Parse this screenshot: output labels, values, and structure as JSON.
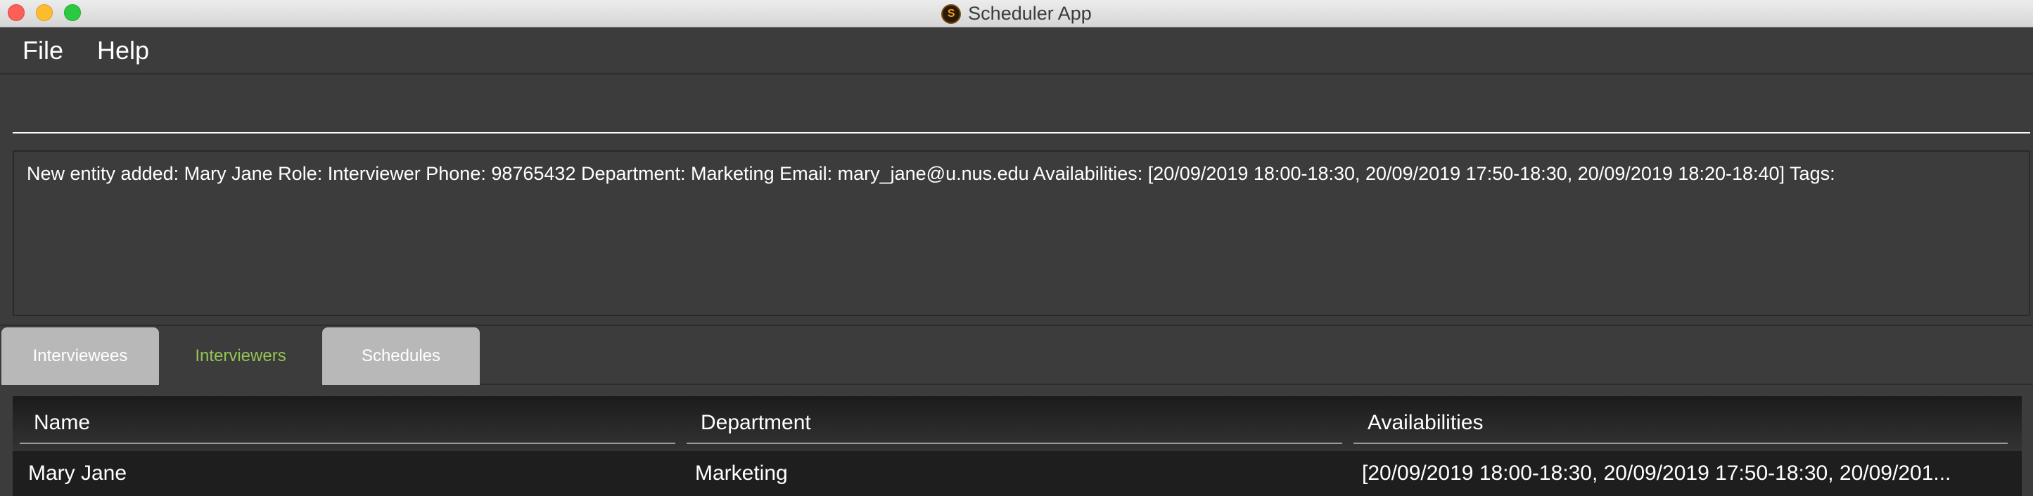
{
  "window": {
    "title": "Scheduler App",
    "app_icon_letter": "S"
  },
  "menu": {
    "items": [
      "File",
      "Help"
    ]
  },
  "command": {
    "value": "",
    "placeholder": ""
  },
  "result": {
    "text": "New entity added: Mary Jane Role: Interviewer Phone: 98765432 Department: Marketing Email: mary_jane@u.nus.edu Availabilities: [20/09/2019 18:00-18:30, 20/09/2019 17:50-18:30, 20/09/2019 18:20-18:40] Tags:"
  },
  "tabs": [
    {
      "label": "Interviewees",
      "selected": false
    },
    {
      "label": "Interviewers",
      "selected": true
    },
    {
      "label": "Schedules",
      "selected": false
    }
  ],
  "table": {
    "columns": [
      "Name",
      "Department",
      "Availabilities"
    ],
    "rows": [
      [
        "Mary Jane",
        "Marketing",
        "[20/09/2019 18:00-18:30, 20/09/2019 17:50-18:30, 20/09/201..."
      ]
    ]
  },
  "colors": {
    "window_bg": "#3c3c3c",
    "selected_tab_text": "#93c454",
    "unselected_tab_bg": "#b8b8b8",
    "table_bg": "#1e1e1e"
  }
}
